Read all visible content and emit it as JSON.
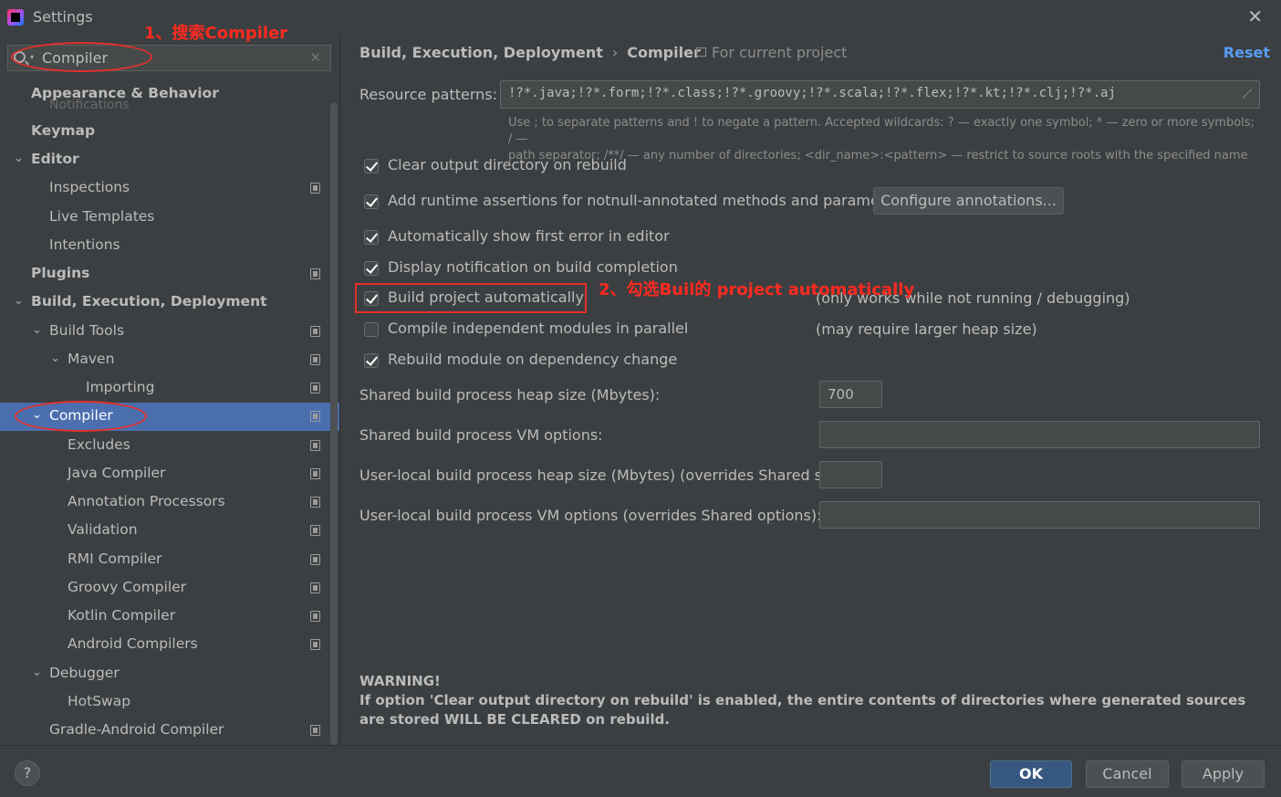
{
  "window": {
    "title": "Settings",
    "close_glyph": "✕"
  },
  "search": {
    "value": "Compiler",
    "clear_glyph": "✕"
  },
  "sidebar": {
    "ghost_text": "Notifications",
    "items": [
      {
        "label": "Appearance & Behavior",
        "bold": true
      },
      {
        "label": "Keymap",
        "bold": true
      },
      {
        "label": "Editor",
        "bold": true,
        "chevron": "⌄"
      },
      {
        "label": "Inspections"
      },
      {
        "label": "Live Templates"
      },
      {
        "label": "Intentions"
      },
      {
        "label": "Plugins",
        "bold": true
      },
      {
        "label": "Build, Execution, Deployment",
        "bold": true,
        "chevron": "⌄"
      },
      {
        "label": "Build Tools",
        "chevron": "⌄"
      },
      {
        "label": "Maven",
        "chevron": "⌄"
      },
      {
        "label": "Importing"
      },
      {
        "label": "Compiler",
        "chevron": "⌄",
        "selected": true
      },
      {
        "label": "Excludes"
      },
      {
        "label": "Java Compiler"
      },
      {
        "label": "Annotation Processors"
      },
      {
        "label": "Validation"
      },
      {
        "label": "RMI Compiler"
      },
      {
        "label": "Groovy Compiler"
      },
      {
        "label": "Kotlin Compiler"
      },
      {
        "label": "Android Compilers"
      },
      {
        "label": "Debugger",
        "chevron": "⌄"
      },
      {
        "label": "HotSwap"
      },
      {
        "label": "Gradle-Android Compiler"
      }
    ]
  },
  "header": {
    "breadcrumb_parent": "Build, Execution, Deployment",
    "breadcrumb_sep": "›",
    "breadcrumb_current": "Compiler",
    "scope": "For current project",
    "reset": "Reset"
  },
  "resource": {
    "label": "Resource patterns:",
    "value": "!?*.java;!?*.form;!?*.class;!?*.groovy;!?*.scala;!?*.flex;!?*.kt;!?*.clj;!?*.aj",
    "hint_line1": "Use ; to separate patterns and ! to negate a pattern. Accepted wildcards: ? — exactly one symbol; * — zero or more symbols; / —",
    "hint_line2": "path separator; /**/ — any number of directories; <dir_name>:<pattern> — restrict to source roots with the specified name"
  },
  "options": {
    "clear_output": {
      "label": "Clear output directory on rebuild",
      "checked": true
    },
    "runtime_assertions": {
      "label": "Add runtime assertions for notnull-annotated methods and parameters",
      "checked": true
    },
    "configure_annotations": "Configure annotations...",
    "show_first_error": {
      "label": "Automatically show first error in editor",
      "checked": true
    },
    "display_notification": {
      "label": "Display notification on build completion",
      "checked": true
    },
    "build_auto": {
      "label": "Build project automatically",
      "checked": true,
      "note": "(only works while not running / debugging)"
    },
    "compile_parallel": {
      "label": "Compile independent modules in parallel",
      "checked": false,
      "note": "(may require larger heap size)"
    },
    "rebuild_on_dep": {
      "label": "Rebuild module on dependency change",
      "checked": true
    }
  },
  "fields": {
    "shared_heap": {
      "label": "Shared build process heap size (Mbytes):",
      "value": "700"
    },
    "shared_vm": {
      "label": "Shared build process VM options:",
      "value": ""
    },
    "local_heap": {
      "label": "User-local build process heap size (Mbytes) (overrides Shared size):",
      "value": ""
    },
    "local_vm": {
      "label": "User-local build process VM options (overrides Shared options):",
      "value": ""
    }
  },
  "warning": {
    "title": "WARNING!",
    "body": "If option 'Clear output directory on rebuild' is enabled, the entire contents of directories where generated sources are stored WILL BE CLEARED on rebuild."
  },
  "annotations": {
    "step1": "1、搜索Compiler",
    "step2": "2、勾选Buil的 project automatically",
    "color": "#e5302a"
  },
  "footer": {
    "help": "?",
    "ok": "OK",
    "cancel": "Cancel",
    "apply": "Apply"
  }
}
